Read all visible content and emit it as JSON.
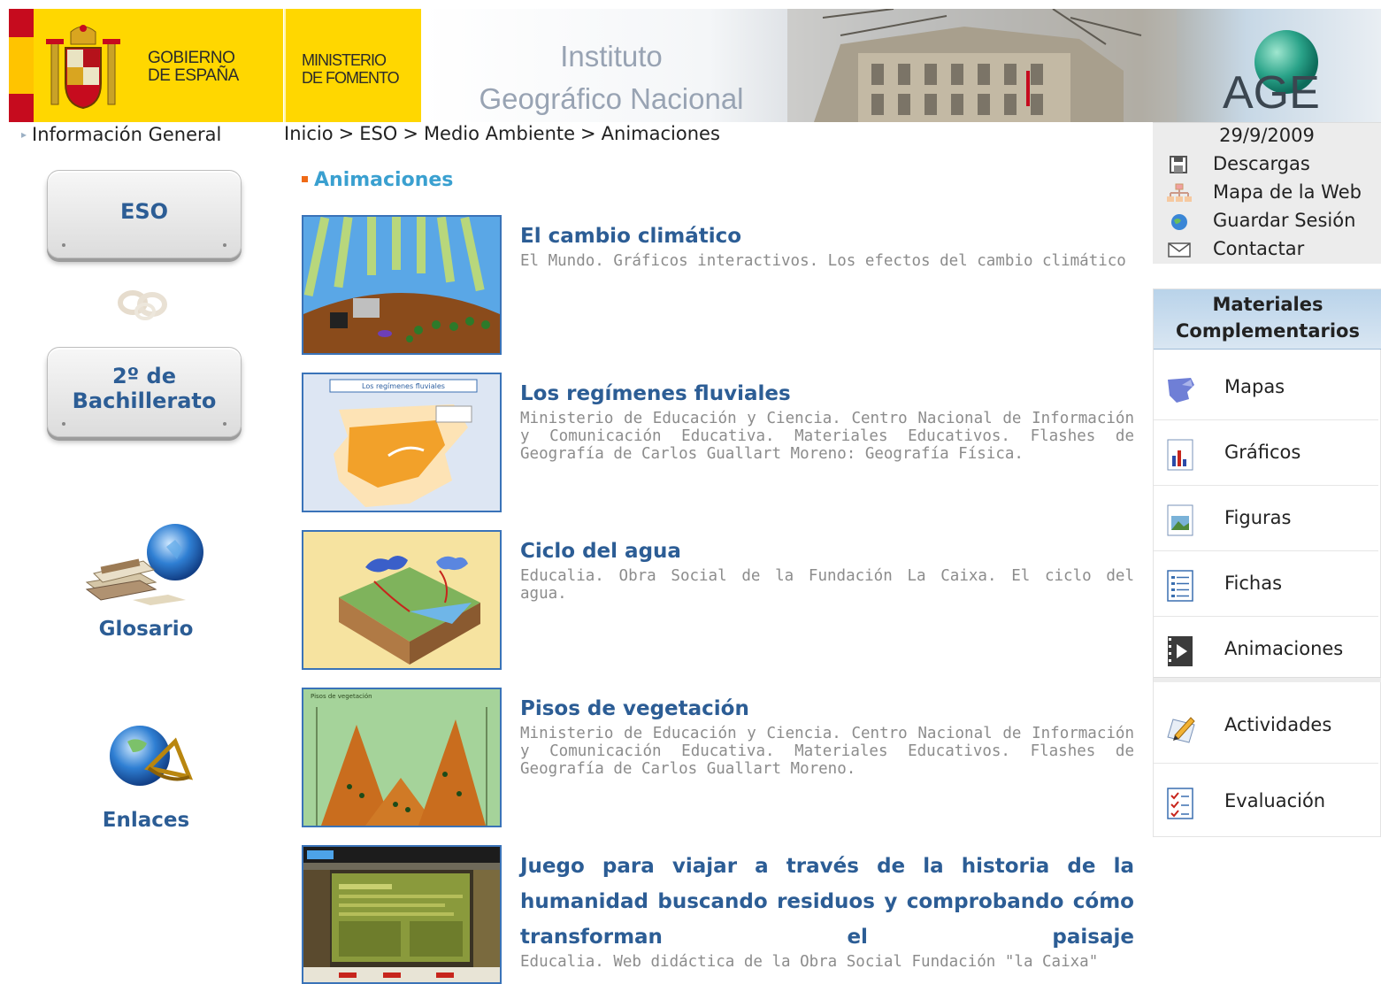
{
  "header": {
    "gov_line1": "GOBIERNO",
    "gov_line2": "DE ESPAÑA",
    "ministry_line1": "MINISTERIO",
    "ministry_line2": "DE FOMENTO",
    "ign_line1": "Instituto",
    "ign_line2": "Geográfico Nacional",
    "age_logo": "AGE"
  },
  "left": {
    "info_general": "Información General",
    "btn_eso": "ESO",
    "btn_bach_line1": "2º de",
    "btn_bach_line2": "Bachillerato",
    "glosario": "Glosario",
    "enlaces": "Enlaces"
  },
  "breadcrumb": {
    "items": [
      "Inicio",
      "ESO",
      "Medio Ambiente",
      "Animaciones"
    ],
    "sep": ">"
  },
  "main": {
    "section_title": "Animaciones",
    "items": [
      {
        "title": "El cambio climático",
        "desc": "El Mundo. Gráficos interactivos. Los efectos del cambio climático"
      },
      {
        "title": "Los regímenes fluviales",
        "desc": "Ministerio de Educación y Ciencia. Centro Nacional de Información y Comunicación Educativa. Materiales Educativos. Flashes de Geografía de Carlos Guallart Moreno: Geografía Física."
      },
      {
        "title": "Ciclo del agua",
        "desc": "Educalia. Obra Social de la Fundación La Caixa. El ciclo del agua."
      },
      {
        "title": "Pisos de vegetación",
        "desc": "Ministerio de Educación y Ciencia. Centro Nacional de Información y Comunicación Educativa. Materiales Educativos. Flashes de Geografía de Carlos Guallart Moreno."
      },
      {
        "title": "Juego para viajar a través de la historia de la humanidad buscando residuos y comprobando cómo transforman el paisaje",
        "desc": "Educalia. Web didáctica de la Obra Social Fundación \"la Caixa\""
      }
    ],
    "thumb2_caption": "Los regímenes fluviales",
    "thumb4_caption": "Pisos de vegetación"
  },
  "right": {
    "date": "29/9/2009",
    "tools": [
      "Descargas",
      "Mapa de la Web",
      "Guardar Sesión",
      "Contactar"
    ],
    "materials_title_line1": "Materiales",
    "materials_title_line2": "Complementarios",
    "materials": [
      "Mapas",
      "Gráficos",
      "Figuras",
      "Fichas",
      "Animaciones",
      "Actividades",
      "Evaluación"
    ]
  },
  "colors": {
    "header_yellow": "#ffd700",
    "link_blue": "#2c5d95",
    "section_blue": "#3aa0d0",
    "bullet_orange": "#ef6a16",
    "thumb_border": "#3a73b8"
  }
}
